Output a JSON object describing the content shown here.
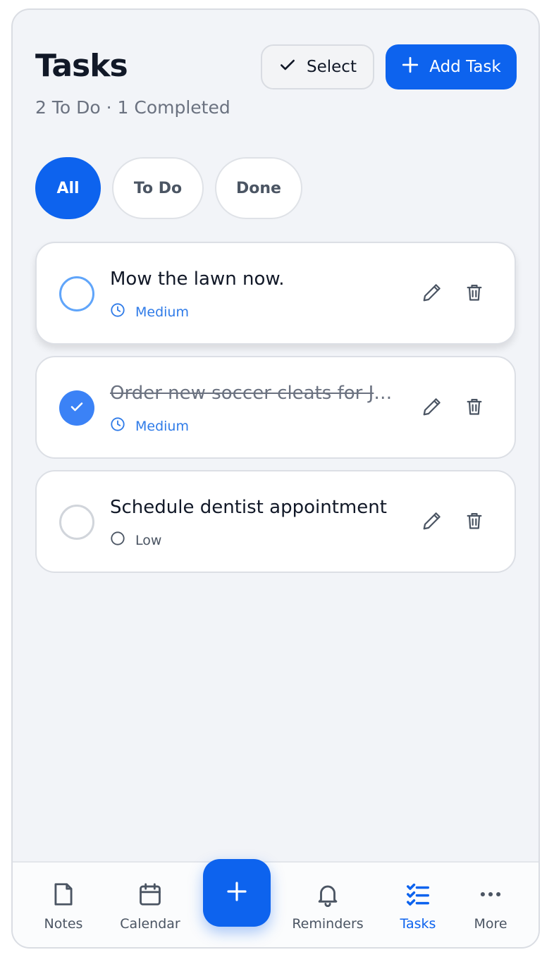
{
  "header": {
    "title": "Tasks",
    "subtitle": "2 To Do · 1 Completed",
    "select_label": "Select",
    "add_label": "Add Task"
  },
  "filters": [
    {
      "label": "All",
      "active": true
    },
    {
      "label": "To Do",
      "active": false
    },
    {
      "label": "Done",
      "active": false
    }
  ],
  "tasks": [
    {
      "title": "Mow the lawn now.",
      "priority": "Medium",
      "completed": false,
      "priority_icon": "clock-icon"
    },
    {
      "title": "Order new soccer cleats for Jake",
      "priority": "Medium",
      "completed": true,
      "priority_icon": "clock-icon"
    },
    {
      "title": "Schedule dentist appointment",
      "priority": "Low",
      "completed": false,
      "priority_icon": "circle-icon"
    }
  ],
  "nav": {
    "items": [
      {
        "label": "Notes",
        "icon": "note-icon"
      },
      {
        "label": "Calendar",
        "icon": "calendar-icon"
      },
      {
        "label": "Reminders",
        "icon": "bell-icon"
      },
      {
        "label": "Tasks",
        "icon": "checklist-icon",
        "active": true
      },
      {
        "label": "More",
        "icon": "more-icon"
      }
    ],
    "fab_icon": "plus-icon"
  },
  "colors": {
    "accent": "#0d63ee",
    "background": "#f2f4f8",
    "priority_medium": "#2f7be8",
    "text_muted": "#6b7280"
  }
}
